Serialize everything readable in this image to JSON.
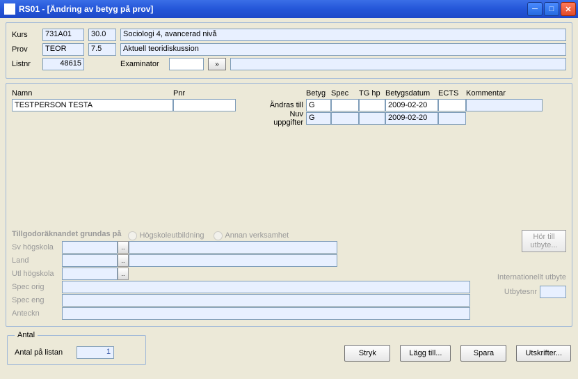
{
  "window": {
    "title": "RS01 - [Ändring av betyg på prov]"
  },
  "course": {
    "kurs_lbl": "Kurs",
    "kurs_code": "731A01",
    "kurs_hp": "30.0",
    "kurs_name": "Sociologi 4, avancerad nivå",
    "prov_lbl": "Prov",
    "prov_code": "TEOR",
    "prov_hp": "7.5",
    "prov_name": "Aktuell teoridiskussion",
    "listnr_lbl": "Listnr",
    "listnr": "48615",
    "examinator_lbl": "Examinator",
    "examinator": "",
    "browse": "»"
  },
  "person": {
    "namn_lbl": "Namn",
    "pnr_lbl": "Pnr",
    "namn": "TESTPERSON TESTA",
    "pnr": ""
  },
  "grades": {
    "head_betyg": "Betyg",
    "head_spec": "Spec",
    "head_tghp": "TG hp",
    "head_datum": "Betygsdatum",
    "head_ects": "ECTS",
    "head_komm": "Kommentar",
    "andras_lbl": "Ändras till",
    "nuv_lbl": "Nuv uppgifter",
    "andras": {
      "betyg": "G",
      "spec": "",
      "tghp": "",
      "datum": "2009-02-20",
      "ects": "",
      "komm": ""
    },
    "nuv": {
      "betyg": "G",
      "spec": "",
      "tghp": "",
      "datum": "2009-02-20",
      "ects": "",
      "komm": ""
    }
  },
  "tillgodo": {
    "title": "Tillgodoräknandet grundas på",
    "r1": "Högskoleutbildning",
    "r2": "Annan verksamhet",
    "sv_lbl": "Sv högskola",
    "land_lbl": "Land",
    "utl_lbl": "Utl högskola",
    "specorig_lbl": "Spec orig",
    "speceng_lbl": "Spec eng",
    "anteckn_lbl": "Anteckn",
    "hor_btn": "Hör till utbyte...",
    "int_lbl": "Internationellt utbyte",
    "utbnr_lbl": "Utbytesnr"
  },
  "antal": {
    "legend": "Antal",
    "label": "Antal på listan",
    "value": "1"
  },
  "buttons": {
    "stryk": "Stryk",
    "lagg": "Lägg till...",
    "spara": "Spara",
    "utskrift": "Utskrifter..."
  }
}
